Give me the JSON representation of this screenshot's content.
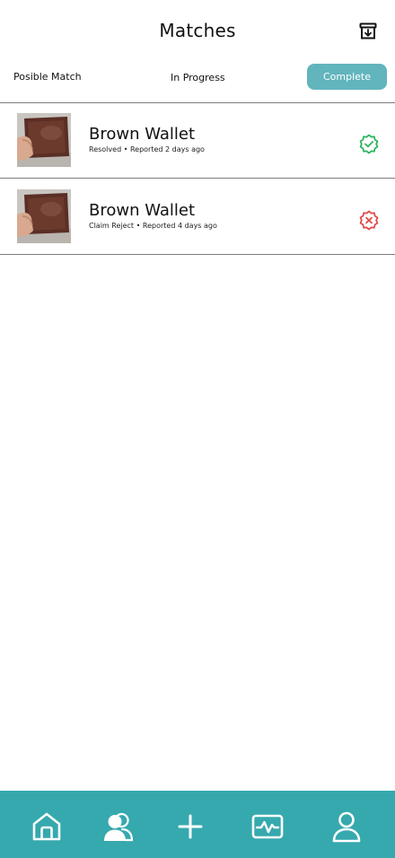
{
  "header": {
    "title": "Matches",
    "archive_icon": "archive-download-icon"
  },
  "tabs": [
    {
      "label": "Posible Match",
      "active": false
    },
    {
      "label": "In Progress",
      "active": false
    },
    {
      "label": "Complete",
      "active": true
    }
  ],
  "colors": {
    "accent": "#62b4bd",
    "nav_bar": "#35a9ae",
    "resolved": "#2db560",
    "rejected": "#e24b4b"
  },
  "matches": [
    {
      "name": "Brown Wallet",
      "status": "Resolved",
      "reported": "Reported 2 days ago",
      "status_icon": "verified-check-icon"
    },
    {
      "name": "Brown Wallet",
      "status": "Claim Reject",
      "reported": "Reported 4 days ago",
      "status_icon": "rejected-x-icon"
    }
  ],
  "bottom_nav": [
    {
      "icon": "home-icon"
    },
    {
      "icon": "people-icon"
    },
    {
      "icon": "plus-icon"
    },
    {
      "icon": "activity-icon"
    },
    {
      "icon": "profile-icon"
    }
  ]
}
